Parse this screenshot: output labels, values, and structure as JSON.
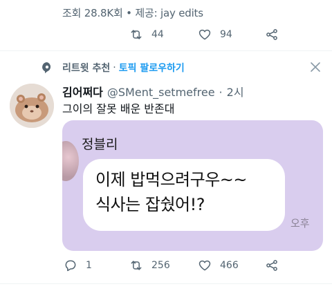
{
  "previous_tweet": {
    "views_text": "조회 28.8K회 • 제공: jay edits",
    "retweets": "44",
    "likes": "94"
  },
  "promo": {
    "label": "리트윗 추천",
    "separator": "·",
    "link": "토픽 팔로우하기"
  },
  "tweet": {
    "display_name": "김어쩌다",
    "handle": "@SMent_setmefree",
    "separator": "·",
    "time": "2시",
    "text": "그이의 잘못 배운 반존대",
    "media": {
      "chat_name": "정블리",
      "bubble_line1": "이제 밥먹으려구우~~",
      "bubble_line2": "식사는 잡쉈어!?",
      "time_label": "오후"
    },
    "replies": "1",
    "retweets": "256",
    "likes": "466"
  },
  "colors": {
    "secondary_text": "#536471",
    "link": "#1d9bf0",
    "media_background": "#d9cdee"
  }
}
